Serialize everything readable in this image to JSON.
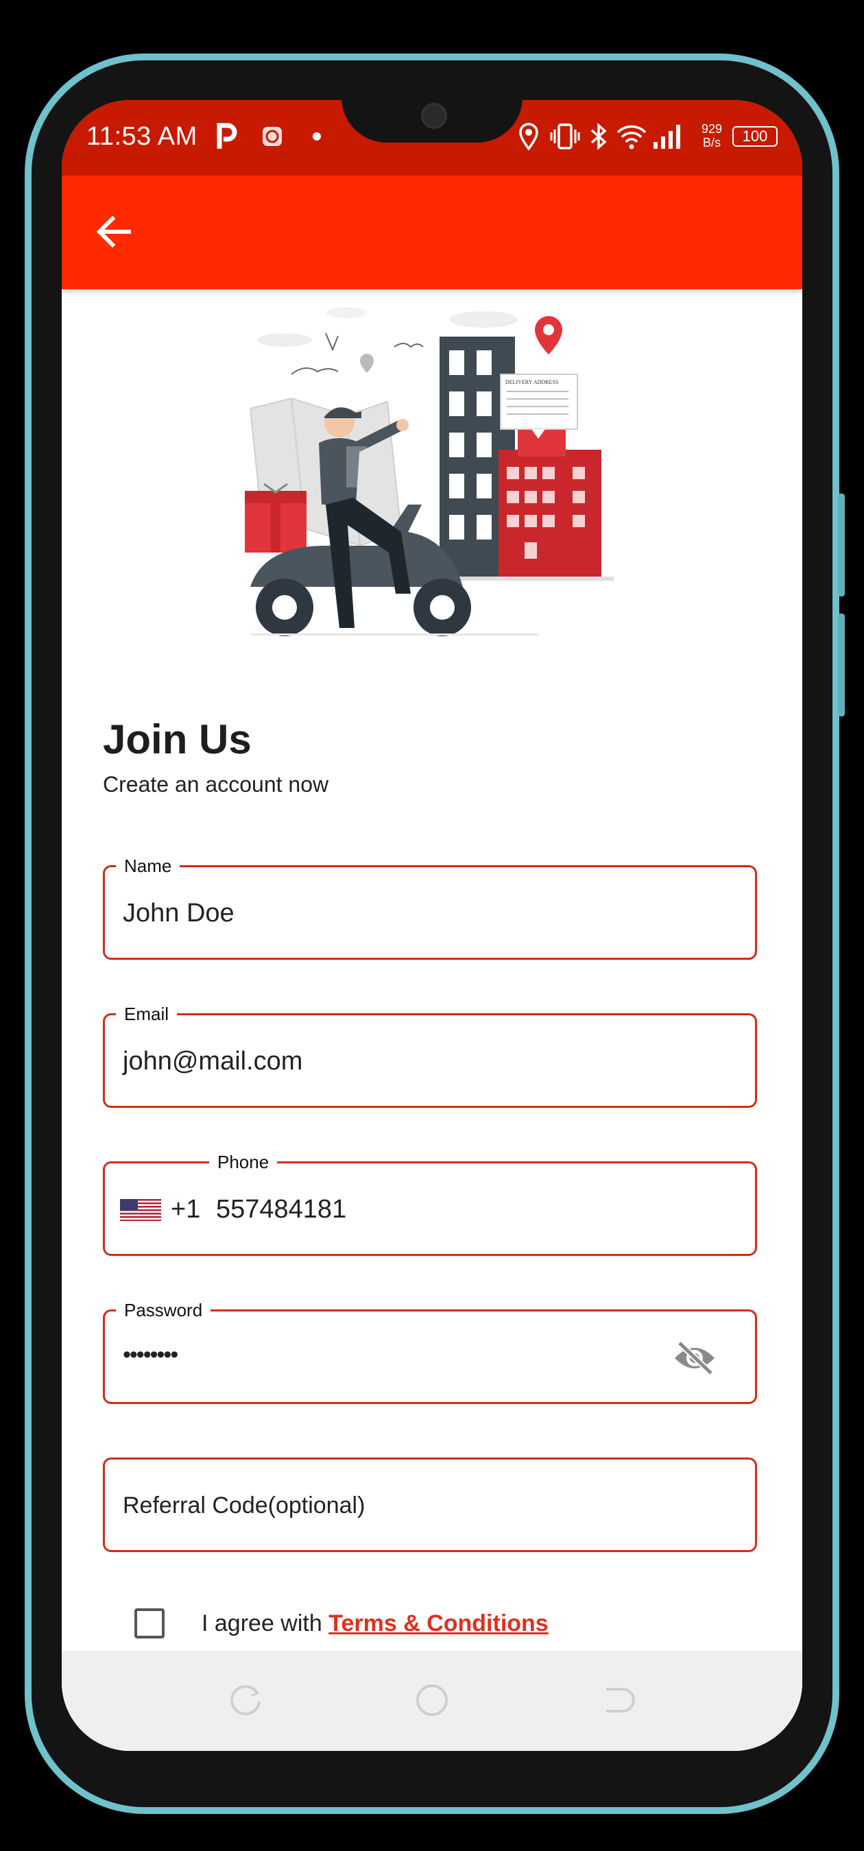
{
  "status_bar": {
    "time": "11:53 AM",
    "net_speed_value": "929",
    "net_speed_unit": "B/s",
    "battery": "100",
    "icons": [
      "parking-app-icon",
      "app-badge-icon",
      "notification-dot-icon",
      "location-icon",
      "vibrate-icon",
      "bluetooth-icon",
      "wifi-icon",
      "signal-icon",
      "battery-icon"
    ]
  },
  "app_bar": {
    "back_icon": "arrow-back-icon"
  },
  "illustration": {
    "sign_text": "DELIVERY ADDRESS"
  },
  "header": {
    "title": "Join Us",
    "subtitle": "Create an account now"
  },
  "form": {
    "name": {
      "label": "Name",
      "value": "John Doe"
    },
    "email": {
      "label": "Email",
      "value": "john@mail.com"
    },
    "phone": {
      "label": "Phone",
      "country_code": "+1",
      "value": "557484181",
      "flag": "us-flag-icon"
    },
    "password": {
      "label": "Password",
      "value": "••••••••",
      "toggle_icon": "eye-off-icon"
    },
    "referral": {
      "placeholder": "Referral Code(optional)"
    }
  },
  "agreement": {
    "checked": false,
    "text": "I agree with",
    "link": "Terms & Conditions"
  },
  "nav": {
    "icons": [
      "recents-icon",
      "home-icon",
      "back-nav-icon"
    ]
  },
  "colors": {
    "status_bar": "#c71a00",
    "app_bar": "#ff2a00",
    "accent": "#d22d14",
    "link": "#e0301c"
  }
}
